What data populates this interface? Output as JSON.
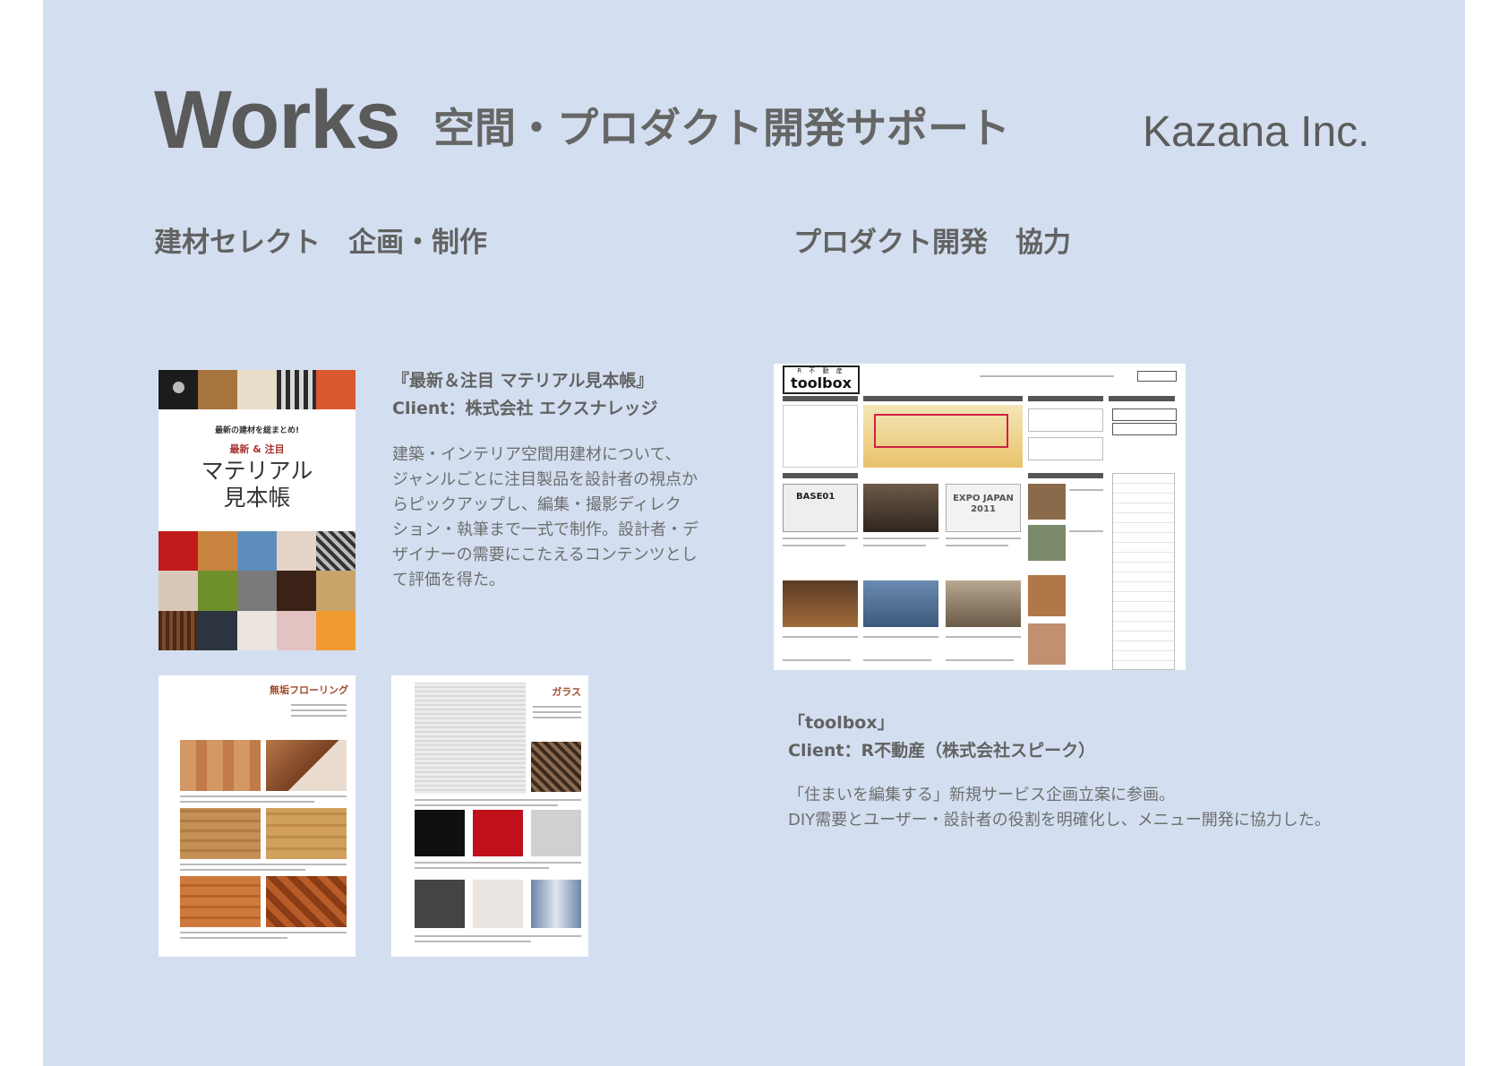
{
  "header": {
    "title": "Works",
    "subtitle": "空間・プロダクト開発サポート",
    "company": "Kazana Inc."
  },
  "left_section": {
    "heading": "建材セレクト　企画・制作",
    "book_cover": {
      "catch": "最新の建材を総まとめ!",
      "series": "最新 & 注目",
      "title_line1": "マテリアル",
      "title_line2": "見本帳"
    },
    "spread1_label": "無垢フローリング",
    "spread2_label": "ガラス",
    "caption_title": "『最新＆注目 マテリアル見本帳』",
    "caption_client": "Client：株式会社 エクスナレッジ",
    "description_lines": [
      "建築・インテリア空間用建材について、",
      "ジャンルごとに注目製品を設計者の視点か",
      "らピックアップし、編集・撮影ディレク",
      "ション・執筆まで一式で制作。設計者・デ",
      "ザイナーの需要にこたえるコンテンツとし",
      "て評価を得た。"
    ]
  },
  "right_section": {
    "heading": "プロダクト開発　協力",
    "screenshot": {
      "logo_small": "R 不 動 産",
      "logo": "toolbox",
      "card_texts": [
        "BASE01",
        "EXPO JAPAN 2011"
      ]
    },
    "caption_title": "「toolbox」",
    "caption_client": "Client：R不動産（株式会社スピーク）",
    "description_lines": [
      "「住まいを編集する」新規サービス企画立案に参画。",
      "DIY需要とユーザー・設計者の役割を明確化し、メニュー開発に協力した。"
    ]
  },
  "colors": {
    "background": "#d3dff0",
    "text": "#5e5e5e"
  }
}
